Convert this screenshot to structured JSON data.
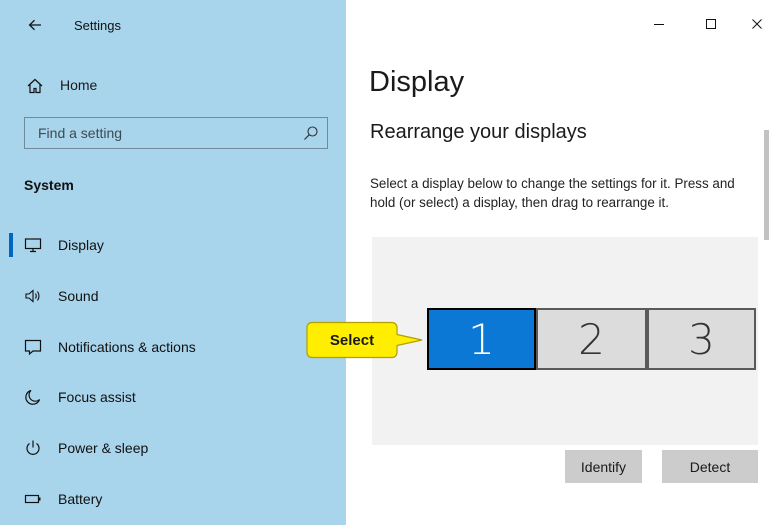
{
  "window": {
    "title": "Settings",
    "controls": [
      "minimize-icon",
      "maximize-icon",
      "close-icon"
    ]
  },
  "sidebar": {
    "home_label": "Home",
    "search": {
      "placeholder": "Find a setting",
      "value": ""
    },
    "section_title": "System",
    "items": [
      {
        "label": "Display",
        "icon": "monitor-icon",
        "selected": true
      },
      {
        "label": "Sound",
        "icon": "speaker-icon",
        "selected": false
      },
      {
        "label": "Notifications & actions",
        "icon": "notification-icon",
        "selected": false
      },
      {
        "label": "Focus assist",
        "icon": "moon-icon",
        "selected": false
      },
      {
        "label": "Power & sleep",
        "icon": "power-icon",
        "selected": false
      },
      {
        "label": "Battery",
        "icon": "battery-icon",
        "selected": false
      }
    ]
  },
  "main": {
    "title": "Display",
    "subtitle": "Rearrange your displays",
    "description": "Select a display below to change the settings for it. Press and hold (or select) a display, then drag to rearrange it.",
    "displays": [
      {
        "label": "1",
        "selected": true
      },
      {
        "label": "2",
        "selected": false
      },
      {
        "label": "3",
        "selected": false
      }
    ],
    "identify_label": "Identify",
    "detect_label": "Detect"
  },
  "annotation": {
    "text": "Select"
  },
  "colors": {
    "sidebar_bg": "#a8d4ec",
    "accent": "#0067c0",
    "selected_display": "#0a78d4",
    "callout_fill": "#ffee00",
    "button_bg": "#cccccc"
  }
}
